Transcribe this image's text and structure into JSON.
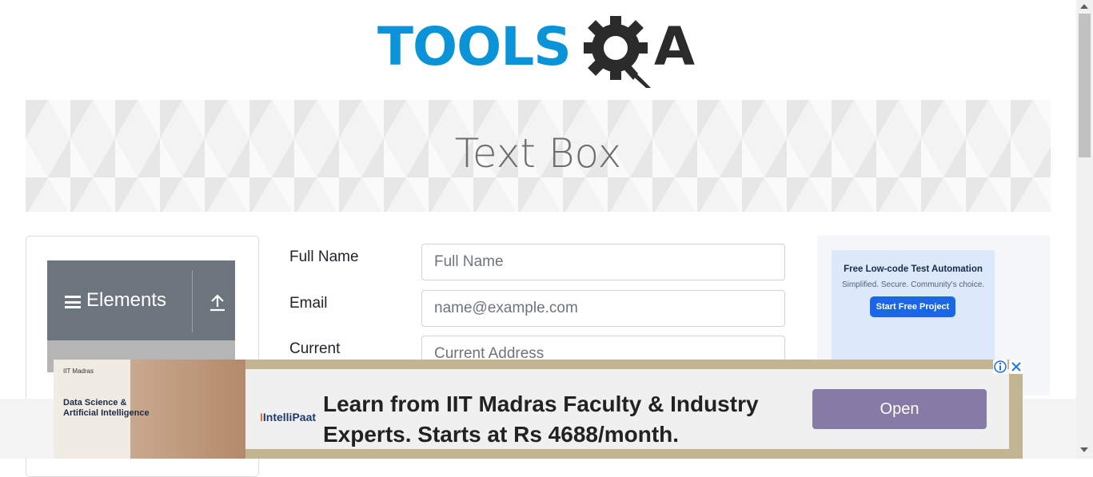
{
  "header": {
    "logo_main": "TOOLS",
    "logo_suffix": "A"
  },
  "banner": {
    "title": "Text Box"
  },
  "sidebar": {
    "group_label": "Elements"
  },
  "form": {
    "full_name_label": "Full Name",
    "full_name_placeholder": "Full Name",
    "email_label": "Email",
    "email_placeholder": "name@example.com",
    "address_label": "Current",
    "address_placeholder": "Current Address"
  },
  "right_ad": {
    "title": "Free Low-code Test Automation",
    "subtitle": "Simplified. Secure. Community's choice.",
    "button": "Start Free Project"
  },
  "bottom_ad": {
    "brand_small": "IIT Madras",
    "image_title": "Data Science & Artificial Intelligence",
    "logo": "IntelliPaat",
    "headline_line1": "Learn from IIT Madras Faculty & Industry",
    "headline_line2": "Experts. Starts at Rs 4688/month.",
    "button": "Open"
  },
  "colors": {
    "brand_blue": "#0b93d8",
    "group_header": "#6c757d",
    "ad_button": "#877aa4"
  },
  "icons": [
    "gear-icon",
    "hamburger-icon",
    "arrow-up-icon",
    "info-icon",
    "close-icon"
  ]
}
